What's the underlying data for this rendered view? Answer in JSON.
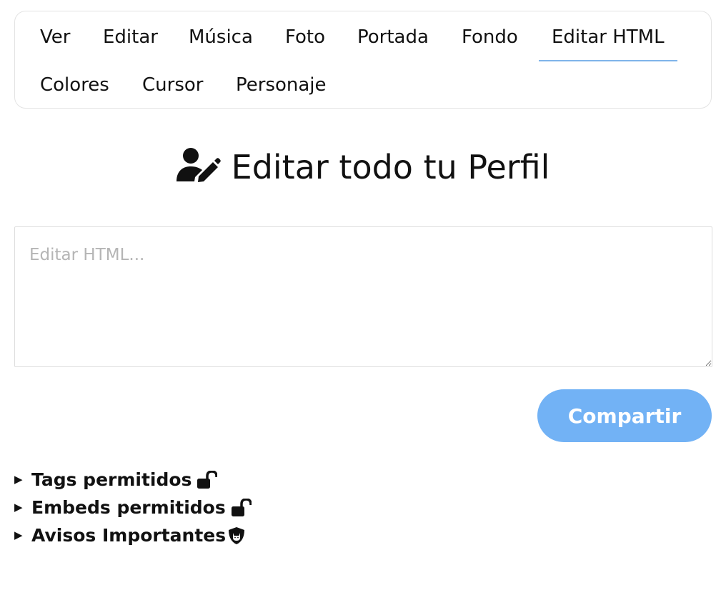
{
  "tabs": [
    {
      "label": "Ver"
    },
    {
      "label": "Editar"
    },
    {
      "label": "Música"
    },
    {
      "label": "Foto"
    },
    {
      "label": "Portada"
    },
    {
      "label": "Fondo"
    },
    {
      "label": "Editar HTML",
      "active": true
    },
    {
      "label": "Colores"
    },
    {
      "label": "Cursor"
    },
    {
      "label": "Personaje"
    }
  ],
  "page": {
    "title": "Editar todo tu Perfil",
    "title_icon": "user-pen-icon"
  },
  "editor": {
    "placeholder": "Editar HTML...",
    "value": ""
  },
  "share": {
    "label": "Compartir",
    "color": "#72b2f5"
  },
  "details": [
    {
      "label": "Tags permitidos",
      "icon": "unlock-icon"
    },
    {
      "label": "Embeds permitidos",
      "icon": "unlock-icon"
    },
    {
      "label": "Avisos Importantes",
      "icon": "shield-cat-icon"
    }
  ],
  "colors": {
    "accent": "#72b2f5",
    "active_tab_underline": "#7fb4ea"
  }
}
